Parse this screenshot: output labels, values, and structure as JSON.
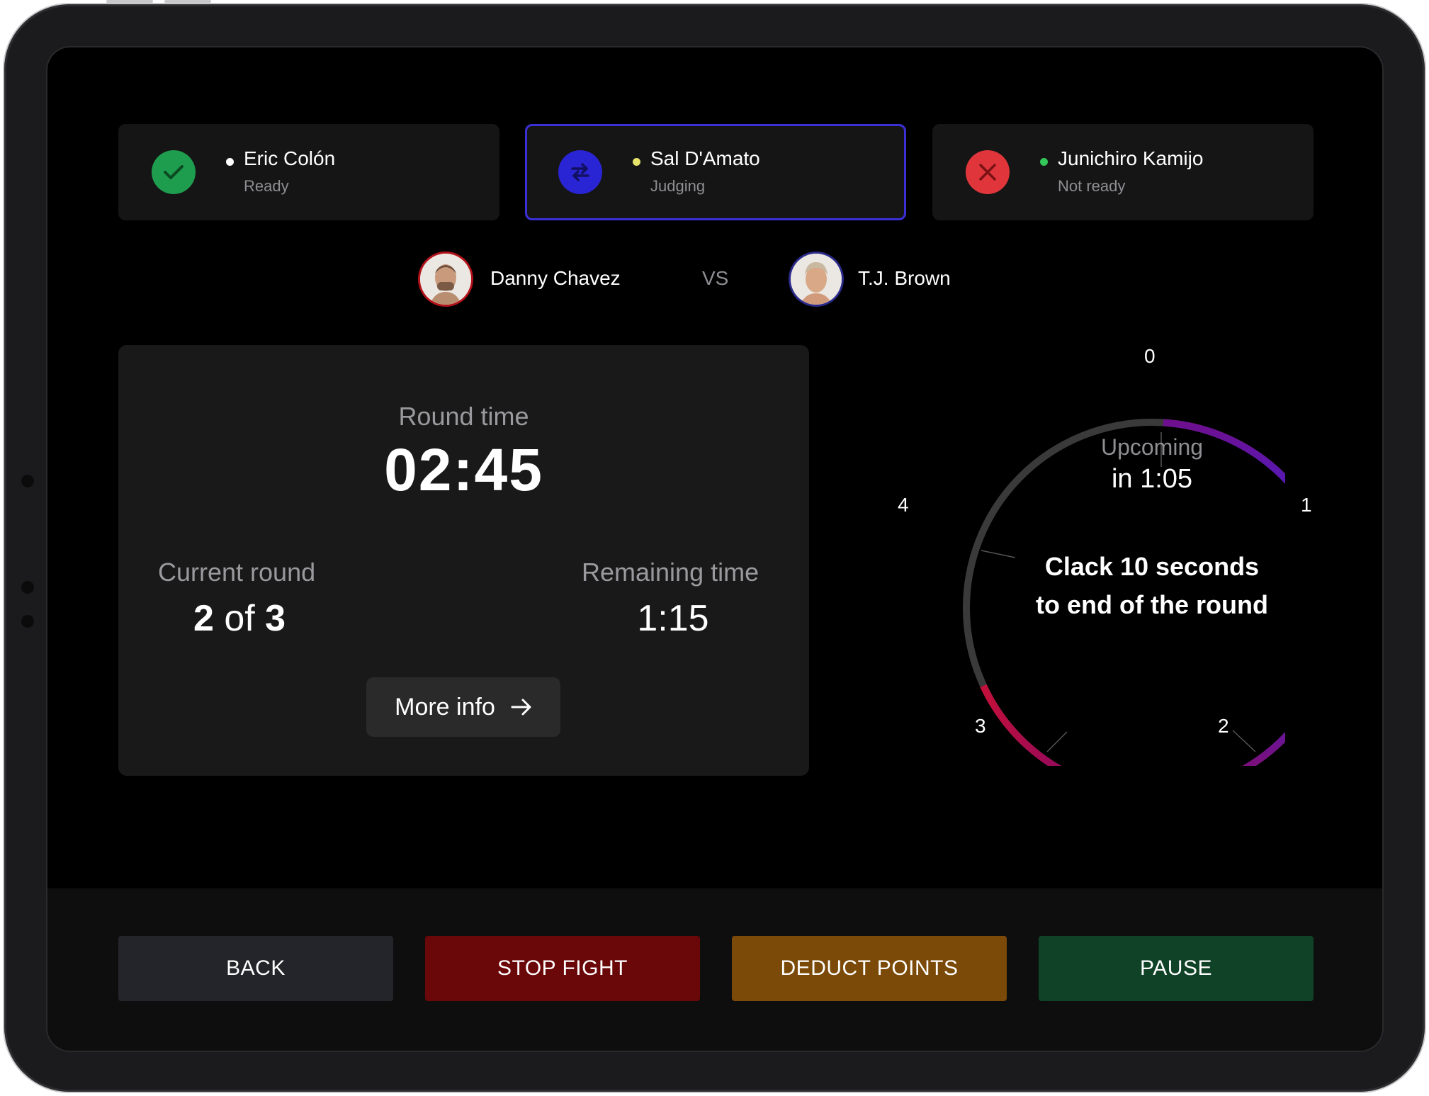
{
  "judges": [
    {
      "name": "Eric Colón",
      "status": "Ready",
      "state": "ready",
      "dot_color": "#ffffff",
      "icon": "check-icon",
      "icon_bg": "#1f9d4f"
    },
    {
      "name": "Sal D'Amato",
      "status": "Judging",
      "state": "judging",
      "dot_color": "#e6e36a",
      "icon": "swap-icon",
      "icon_bg": "#2a25d4"
    },
    {
      "name": "Junichiro Kamijo",
      "status": "Not ready",
      "state": "not-ready",
      "dot_color": "#34c759",
      "icon": "close-icon",
      "icon_bg": "#e0363b"
    }
  ],
  "fight": {
    "red_corner": {
      "name": "Danny Chavez",
      "ring_color": "#b3121a"
    },
    "vs_label": "VS",
    "blue_corner": {
      "name": "T.J. Brown",
      "ring_color": "#2a2a8a"
    }
  },
  "round_info": {
    "round_time_label": "Round time",
    "round_time": "02:45",
    "current_round_label": "Current round",
    "current_round": "2",
    "of_label": "of",
    "total_rounds": "3",
    "remaining_label": "Remaining time",
    "remaining_time": "1:15",
    "more_info_label": "More info"
  },
  "clock": {
    "upcoming_label": "Upcoming",
    "upcoming_time": "in 1:05",
    "message_line1": "Clack 10 seconds",
    "message_line2": "to end of the round",
    "markers": [
      "0",
      "1",
      "2",
      "3",
      "4"
    ],
    "arc_colors": {
      "start": "#6e0f8f",
      "mid": "#4b1fc8",
      "end": "#c2103a",
      "track": "#3a3a3a"
    }
  },
  "actions": {
    "back": "BACK",
    "stop_fight": "STOP FIGHT",
    "deduct_points": "DEDUCT POINTS",
    "pause": "PAUSE"
  },
  "colors": {
    "back": "#24252a",
    "stop_fight": "#6a0709",
    "deduct_points": "#7b4a08",
    "pause": "#0f4226"
  }
}
